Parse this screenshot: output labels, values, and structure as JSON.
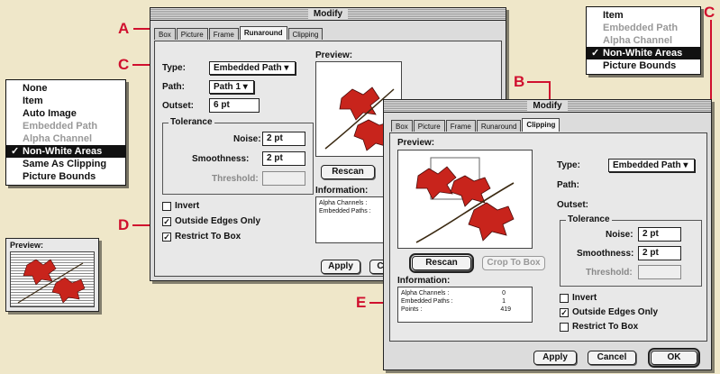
{
  "callouts": {
    "a": "A",
    "b": "B",
    "c_left": "C",
    "c_right": "C",
    "d": "D",
    "e": "E"
  },
  "dialog_back": {
    "title": "Modify",
    "tabs": [
      "Box",
      "Picture",
      "Frame",
      "Runaround",
      "Clipping"
    ],
    "active_tab": "Runaround",
    "type_label": "Type:",
    "type_value": "Embedded Path",
    "path_label": "Path:",
    "path_value": "Path 1",
    "outset_label": "Outset:",
    "outset_value": "6 pt",
    "tolerance_title": "Tolerance",
    "noise_label": "Noise:",
    "noise_value": "2 pt",
    "smoothness_label": "Smoothness:",
    "smoothness_value": "2 pt",
    "threshold_label": "Threshold:",
    "invert_label": "Invert",
    "outside_label": "Outside Edges Only",
    "restrict_label": "Restrict To Box",
    "preview_label": "Preview:",
    "rescan_label": "Rescan",
    "information_label": "Information:",
    "info_lines": [
      "Alpha Channels :",
      "Embedded Paths :"
    ],
    "apply_label": "Apply",
    "cancel_partial": "C"
  },
  "dialog_front": {
    "title": "Modify",
    "tabs": [
      "Box",
      "Picture",
      "Frame",
      "Runaround",
      "Clipping"
    ],
    "active_tab": "Clipping",
    "preview_label": "Preview:",
    "type_label": "Type:",
    "type_value": "Embedded Path",
    "path_label": "Path:",
    "outset_label": "Outset:",
    "tolerance_title": "Tolerance",
    "noise_label": "Noise:",
    "noise_value": "2 pt",
    "smoothness_label": "Smoothness:",
    "smoothness_value": "2 pt",
    "threshold_label": "Threshold:",
    "rescan_label": "Rescan",
    "crop_label": "Crop To Box",
    "information_label": "Information:",
    "info_rows": [
      {
        "label": "Alpha Channels :",
        "value": "0"
      },
      {
        "label": "Embedded Paths :",
        "value": "1"
      },
      {
        "label": "Points :",
        "value": "419"
      }
    ],
    "invert_label": "Invert",
    "outside_label": "Outside Edges Only",
    "restrict_label": "Restrict To Box",
    "apply_label": "Apply",
    "cancel_label": "Cancel",
    "ok_label": "OK"
  },
  "menu_left": {
    "items": [
      {
        "label": "None",
        "state": "enabled"
      },
      {
        "label": "Item",
        "state": "enabled"
      },
      {
        "label": "Auto Image",
        "state": "enabled"
      },
      {
        "label": "Embedded Path",
        "state": "disabled"
      },
      {
        "label": "Alpha Channel",
        "state": "disabled"
      },
      {
        "label": "Non-White Areas",
        "state": "selected"
      },
      {
        "label": "Same As Clipping",
        "state": "enabled"
      },
      {
        "label": "Picture Bounds",
        "state": "enabled"
      }
    ]
  },
  "menu_right": {
    "items": [
      {
        "label": "Item",
        "state": "enabled"
      },
      {
        "label": "Embedded Path",
        "state": "disabled"
      },
      {
        "label": "Alpha Channel",
        "state": "disabled"
      },
      {
        "label": "Non-White Areas",
        "state": "selected"
      },
      {
        "label": "Picture Bounds",
        "state": "enabled"
      }
    ]
  },
  "small_preview": {
    "label": "Preview:"
  },
  "colors": {
    "callout": "#d0102e",
    "leaf": "#c8241c",
    "background": "#efe7c9"
  }
}
